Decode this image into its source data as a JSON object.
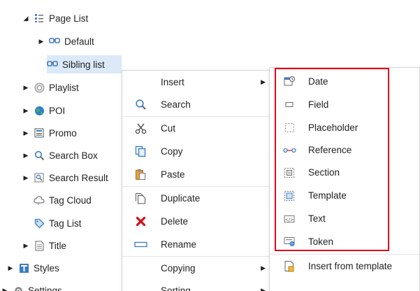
{
  "tree": {
    "page_list": "Page List",
    "default": "Default",
    "sibling_list": "Sibling list",
    "playlist": "Playlist",
    "poi": "POI",
    "promo": "Promo",
    "search_box": "Search Box",
    "search_results": "Search Result",
    "tag_cloud": "Tag Cloud",
    "tag_list": "Tag List",
    "title": "Title",
    "styles": "Styles",
    "settings": "Settings"
  },
  "context_menu": {
    "insert": "Insert",
    "search": "Search",
    "cut": "Cut",
    "copy": "Copy",
    "paste": "Paste",
    "duplicate": "Duplicate",
    "delete": "Delete",
    "rename": "Rename",
    "copying": "Copying",
    "sorting": "Sorting"
  },
  "insert_submenu": {
    "date": "Date",
    "field": "Field",
    "placeholder": "Placeholder",
    "reference": "Reference",
    "section": "Section",
    "template": "Template",
    "text": "Text",
    "token": "Token",
    "insert_from_template": "Insert from template"
  },
  "colors": {
    "selection": "#dbe9f8",
    "highlight_border": "#e1001a",
    "delete_icon": "#d0101a"
  }
}
